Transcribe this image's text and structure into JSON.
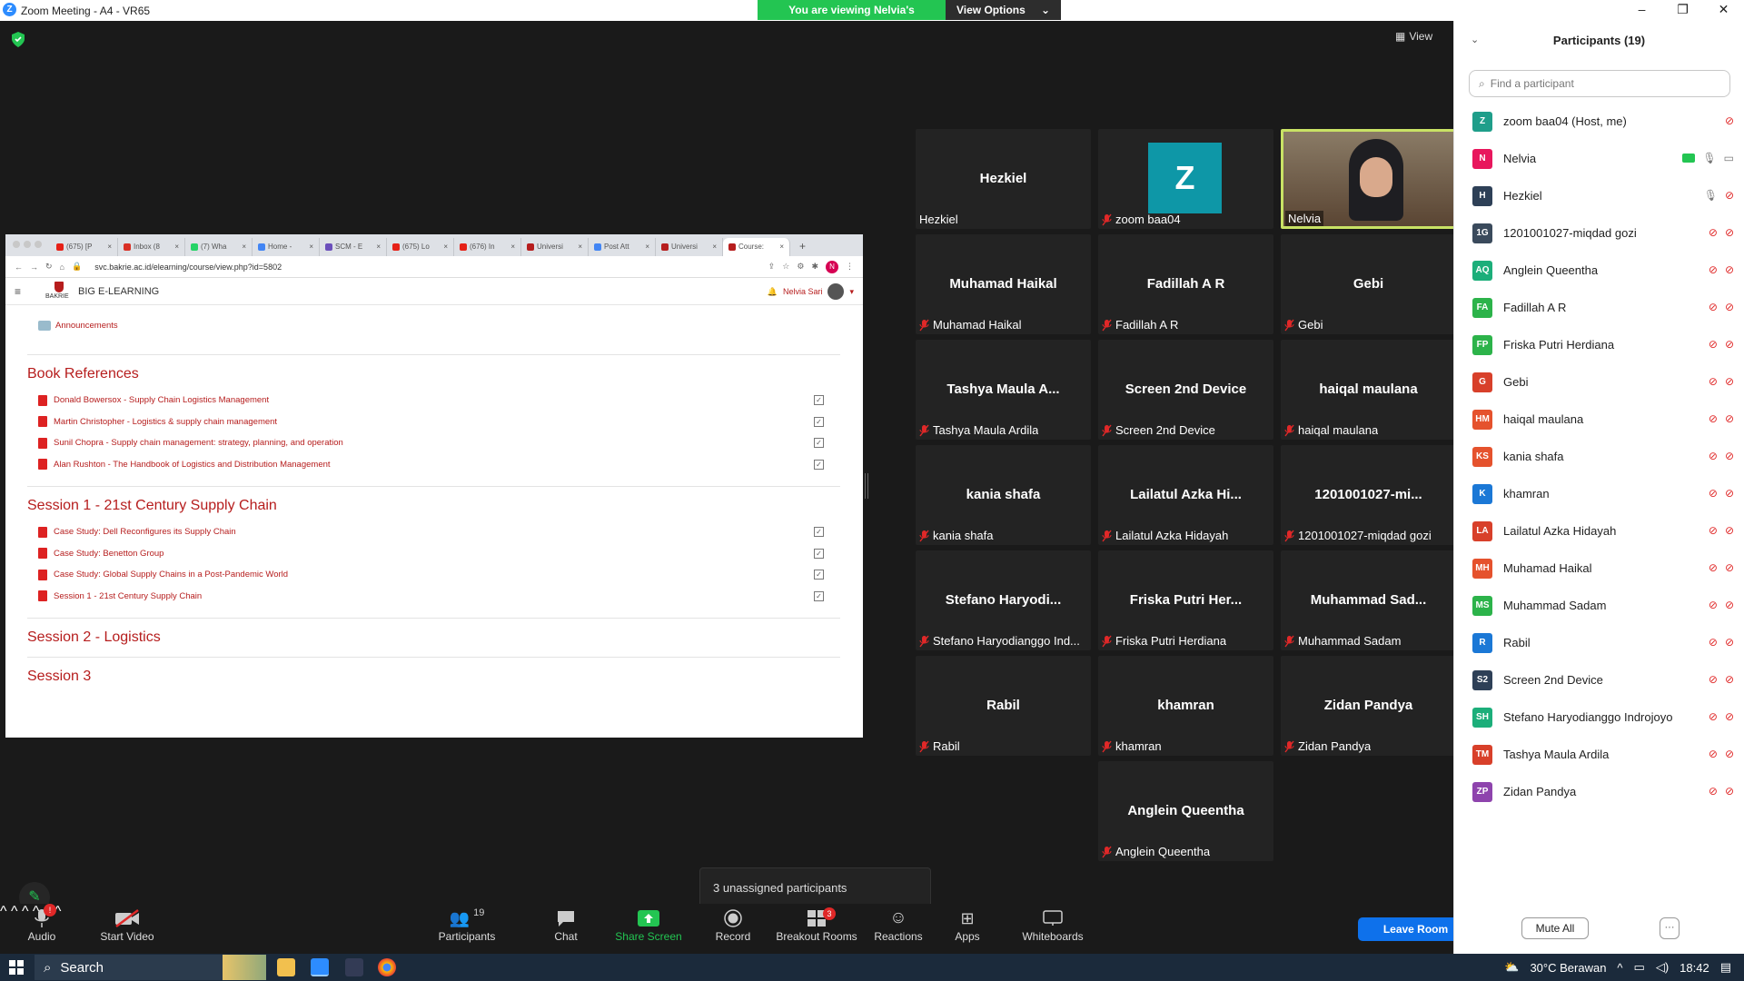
{
  "window": {
    "title": "Zoom Meeting - A4 - VR65",
    "viewing_banner": "You are viewing Nelvia's screen",
    "view_options": "View Options",
    "view_label": "View"
  },
  "browser": {
    "tabs": [
      {
        "label": "(675) [P",
        "color": "#e62117"
      },
      {
        "label": "Inbox (8",
        "color": "#d93025"
      },
      {
        "label": "(7) Wha",
        "color": "#25d366"
      },
      {
        "label": "Home -",
        "color": "#4285f4"
      },
      {
        "label": "SCM - E",
        "color": "#6b4fbb"
      },
      {
        "label": "(675) Lo",
        "color": "#e62117"
      },
      {
        "label": "(676) In",
        "color": "#e62117"
      },
      {
        "label": "Universi",
        "color": "#b61d1d"
      },
      {
        "label": "Post Att",
        "color": "#4285f4"
      },
      {
        "label": "Universi",
        "color": "#b61d1d"
      },
      {
        "label": "Course:",
        "color": "#b61d1d"
      }
    ],
    "url": "svc.bakrie.ac.id/elearning/course/view.php?id=5802",
    "brand": "BIG E-LEARNING",
    "logo_text": "BAKRIE",
    "user_name": "Nelvia Sari",
    "profile_initial": "N"
  },
  "course": {
    "announcements": "Announcements",
    "sections": [
      {
        "title": "Book References",
        "items": [
          "Donald Bowersox - Supply Chain Logistics Management",
          "Martin Christopher - Logistics & supply chain management",
          "Sunil Chopra - Supply chain management: strategy, planning, and operation",
          "Alan Rushton - The Handbook of Logistics and Distribution Management"
        ]
      },
      {
        "title": "Session 1 - 21st Century Supply Chain",
        "items": [
          "Case Study: Dell Reconfigures its Supply Chain",
          "Case Study: Benetton Group",
          "Case Study: Global Supply Chains in a Post-Pandemic World",
          "Session 1 - 21st Century Supply Chain"
        ]
      },
      {
        "title": "Session 2 - Logistics",
        "items": []
      },
      {
        "title": "Session 3",
        "items": []
      }
    ]
  },
  "gallery": [
    {
      "big": "Hezkiel",
      "label": "Hezkiel",
      "muted": false
    },
    {
      "big": "Z",
      "label": "zoom baa04",
      "muted": true,
      "avatar": true
    },
    {
      "big": "",
      "label": "Nelvia",
      "muted": false,
      "video": true
    },
    {
      "big": "Muhamad Haikal",
      "label": "Muhamad Haikal",
      "muted": true
    },
    {
      "big": "Fadillah A R",
      "label": "Fadillah A R",
      "muted": true
    },
    {
      "big": "Gebi",
      "label": "Gebi",
      "muted": true
    },
    {
      "big": "Tashya Maula A...",
      "label": "Tashya Maula Ardila",
      "muted": true
    },
    {
      "big": "Screen 2nd Device",
      "label": "Screen 2nd Device",
      "muted": true
    },
    {
      "big": "haiqal maulana",
      "label": "haiqal maulana",
      "muted": true
    },
    {
      "big": "kania shafa",
      "label": "kania shafa",
      "muted": true
    },
    {
      "big": "Lailatul Azka Hi...",
      "label": "Lailatul Azka Hidayah",
      "muted": true
    },
    {
      "big": "1201001027-mi...",
      "label": "1201001027-miqdad gozi",
      "muted": true
    },
    {
      "big": "Stefano Haryodi...",
      "label": "Stefano Haryodianggo Ind...",
      "muted": true
    },
    {
      "big": "Friska Putri Her...",
      "label": "Friska Putri Herdiana",
      "muted": true
    },
    {
      "big": "Muhammad Sad...",
      "label": "Muhammad Sadam",
      "muted": true
    },
    {
      "big": "Rabil",
      "label": "Rabil",
      "muted": true
    },
    {
      "big": "khamran",
      "label": "khamran",
      "muted": true
    },
    {
      "big": "Zidan Pandya",
      "label": "Zidan Pandya",
      "muted": true
    },
    {
      "big": "Anglein Queentha",
      "label": "Anglein Queentha",
      "muted": true
    }
  ],
  "unassigned": "3 unassigned participants",
  "toolbar": {
    "audio": "Audio",
    "audio_badge": "!",
    "start_video": "Start Video",
    "participants": "Participants",
    "participants_count": "19",
    "chat": "Chat",
    "share_screen": "Share Screen",
    "record": "Record",
    "breakout_rooms": "Breakout Rooms",
    "breakout_badge": "3",
    "reactions": "Reactions",
    "apps": "Apps",
    "whiteboards": "Whiteboards",
    "leave_room": "Leave Room"
  },
  "panel": {
    "title": "Participants (19)",
    "find_placeholder": "Find a participant",
    "participants": [
      {
        "initials": "Z",
        "name": "zoom baa04 (Host, me)",
        "color": "#1f9e8a",
        "state": "host"
      },
      {
        "initials": "N",
        "name": "Nelvia",
        "color": "#e8175d",
        "state": "sharing"
      },
      {
        "initials": "H",
        "name": "Hezkiel",
        "color": "#2e4057",
        "state": "audio"
      },
      {
        "initials": "1G",
        "name": "1201001027-miqdad gozi",
        "color": "#3a4a5c",
        "state": "muted"
      },
      {
        "initials": "AQ",
        "name": "Anglein Queentha",
        "color": "#1cae7a",
        "state": "muted"
      },
      {
        "initials": "FA",
        "name": "Fadillah A R",
        "color": "#2cb34a",
        "state": "muted"
      },
      {
        "initials": "FP",
        "name": "Friska Putri Herdiana",
        "color": "#2cb34a",
        "state": "muted"
      },
      {
        "initials": "G",
        "name": "Gebi",
        "color": "#d8402a",
        "state": "muted"
      },
      {
        "initials": "HM",
        "name": "haiqal maulana",
        "color": "#e5522d",
        "state": "muted"
      },
      {
        "initials": "KS",
        "name": "kania shafa",
        "color": "#e5522d",
        "state": "muted"
      },
      {
        "initials": "K",
        "name": "khamran",
        "color": "#1b78d6",
        "state": "muted"
      },
      {
        "initials": "LA",
        "name": "Lailatul Azka Hidayah",
        "color": "#d8402a",
        "state": "muted"
      },
      {
        "initials": "MH",
        "name": "Muhamad Haikal",
        "color": "#e5522d",
        "state": "muted"
      },
      {
        "initials": "MS",
        "name": "Muhammad Sadam",
        "color": "#2cb34a",
        "state": "muted"
      },
      {
        "initials": "R",
        "name": "Rabil",
        "color": "#1b78d6",
        "state": "muted"
      },
      {
        "initials": "S2",
        "name": "Screen 2nd Device",
        "color": "#2e4057",
        "state": "muted"
      },
      {
        "initials": "SH",
        "name": "Stefano Haryodianggo Indrojoyo",
        "color": "#1cae7a",
        "state": "muted"
      },
      {
        "initials": "TM",
        "name": "Tashya Maula Ardila",
        "color": "#d8402a",
        "state": "muted"
      },
      {
        "initials": "ZP",
        "name": "Zidan Pandya",
        "color": "#8e44ad",
        "state": "muted"
      }
    ],
    "mute_all": "Mute All",
    "more": "···"
  },
  "taskbar": {
    "search": "Search",
    "weather": "30°C  Berawan",
    "time": "18:42"
  }
}
